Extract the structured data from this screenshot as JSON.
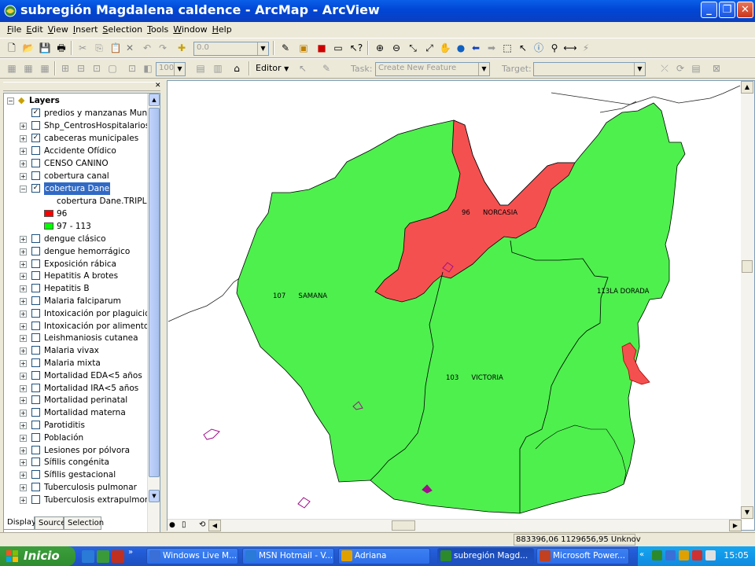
{
  "window": {
    "title": "subregión Magdalena caldence - ArcMap - ArcView"
  },
  "menubar": {
    "items": [
      "File",
      "Edit",
      "View",
      "Insert",
      "Selection",
      "Tools",
      "Window",
      "Help"
    ]
  },
  "toolbar1": {
    "scale_value": "0.0"
  },
  "toolbar2": {
    "zoom_value": "100",
    "editor_label": "Editor",
    "task_label": "Task:",
    "task_value": "Create New Feature",
    "target_label": "Target:",
    "target_value": ""
  },
  "toc": {
    "root_label": "Layers",
    "layers": [
      {
        "label": "predios y manzanas Municip",
        "checked": true,
        "expander": false
      },
      {
        "label": "Shp_CentrosHospitalarios",
        "checked": false,
        "expander": true
      },
      {
        "label": "cabeceras municipales",
        "checked": true,
        "expander": true
      },
      {
        "label": "Accidente Ofídico",
        "checked": false,
        "expander": true
      },
      {
        "label": "CENSO CANINO",
        "checked": false,
        "expander": true
      },
      {
        "label": "cobertura canal",
        "checked": false,
        "expander": true
      },
      {
        "label": "cobertura Dane",
        "checked": true,
        "expander": true,
        "selected": true
      }
    ],
    "sublayer_field": "cobertura Dane.TRIPLE_",
    "legend": [
      {
        "label": "96",
        "color": "#ff0000"
      },
      {
        "label": "97 - 113",
        "color": "#00ff00"
      }
    ],
    "layers_after": [
      "dengue clásico",
      "dengue hemorrágico",
      "Exposición rábica",
      "Hepatitis A brotes",
      "Hepatitis B",
      "Malaria falciparum",
      "Intoxicación por plaguicidas",
      "Intoxicación por alimentos",
      "Leishmaniosis cutanea",
      "Malaria vivax",
      "Malaria mixta",
      "Mortalidad EDA<5 años",
      "Mortalidad IRA<5 años",
      "Mortalidad perinatal",
      "Mortalidad materna",
      "Parotiditis",
      "Población",
      "Lesiones por pólvora",
      "Sífilis congénita",
      "Sífilis gestacional",
      "Tuberculosis pulmonar",
      "Tuberculosis extrapulmonar"
    ],
    "tabs": [
      "Display",
      "Source",
      "Selection"
    ]
  },
  "map": {
    "colors": {
      "red_region": "#f55050",
      "green_region": "#4ef04e",
      "outline": "#000000",
      "accent_purple": "#a0108a"
    },
    "labels": [
      {
        "code": "96",
        "name": "NORCASIA"
      },
      {
        "code": "107",
        "name": "SAMANA"
      },
      {
        "code": "113",
        "name": "LA DORADA"
      },
      {
        "code": "103",
        "name": "VICTORIA"
      }
    ]
  },
  "statusbar": {
    "coordinates": "883396,06  1129656,95 Unknov"
  },
  "taskbar": {
    "start_label": "Inicio",
    "tasks": [
      {
        "label": "Windows Live M...",
        "active": false
      },
      {
        "label": "MSN Hotmail - V...",
        "active": false
      },
      {
        "label": "Adriana",
        "active": false
      },
      {
        "label": "subregión Magd...",
        "active": true
      },
      {
        "label": "Microsoft Power...",
        "active": false
      }
    ],
    "clock": "15:05"
  }
}
